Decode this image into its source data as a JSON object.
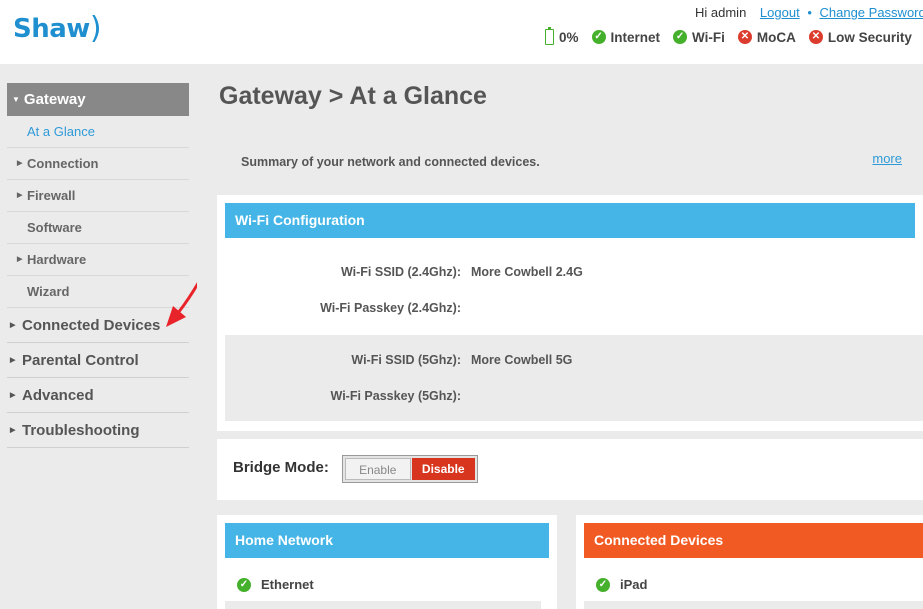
{
  "header": {
    "brand": "Shaw",
    "brand_mark": ")",
    "greeting": "Hi admin",
    "logout": "Logout",
    "separator": "•",
    "change_password": "Change Password",
    "status": {
      "battery": "0%",
      "internet": "Internet",
      "wifi": "Wi-Fi",
      "moca": "MoCA",
      "low_security": "Low Security"
    }
  },
  "sidebar": {
    "gateway": "Gateway",
    "sub_items": [
      {
        "label": "At a Glance"
      },
      {
        "label": "Connection"
      },
      {
        "label": "Firewall"
      },
      {
        "label": "Software"
      },
      {
        "label": "Hardware"
      },
      {
        "label": "Wizard"
      }
    ],
    "main_items": [
      {
        "label": "Connected Devices"
      },
      {
        "label": "Parental Control"
      },
      {
        "label": "Advanced"
      },
      {
        "label": "Troubleshooting"
      }
    ]
  },
  "main": {
    "title": "Gateway > At a Glance",
    "summary": "Summary of your network and connected devices.",
    "more": "more",
    "wifi_config": {
      "title": "Wi-Fi Configuration",
      "ssid_24_label": "Wi-Fi SSID (2.4Ghz):",
      "ssid_24_value": "More Cowbell 2.4G",
      "passkey_24_label": "Wi-Fi Passkey (2.4Ghz):",
      "ssid_5_label": "Wi-Fi SSID (5Ghz):",
      "ssid_5_value": "More Cowbell 5G",
      "passkey_5_label": "Wi-Fi Passkey (5Ghz):"
    },
    "bridge": {
      "label": "Bridge Mode:",
      "enable": "Enable",
      "disable": "Disable"
    },
    "home_network": {
      "title": "Home Network",
      "items": [
        "Ethernet"
      ]
    },
    "connected_devices": {
      "title": "Connected Devices",
      "items": [
        "iPad"
      ]
    }
  },
  "colors": {
    "brand_blue": "#1f8fd0",
    "panel_blue": "#44b5e6",
    "panel_orange": "#f15a22",
    "ok_green": "#45b02c",
    "error_red": "#dc3c2d",
    "disable_red": "#d8351f"
  }
}
